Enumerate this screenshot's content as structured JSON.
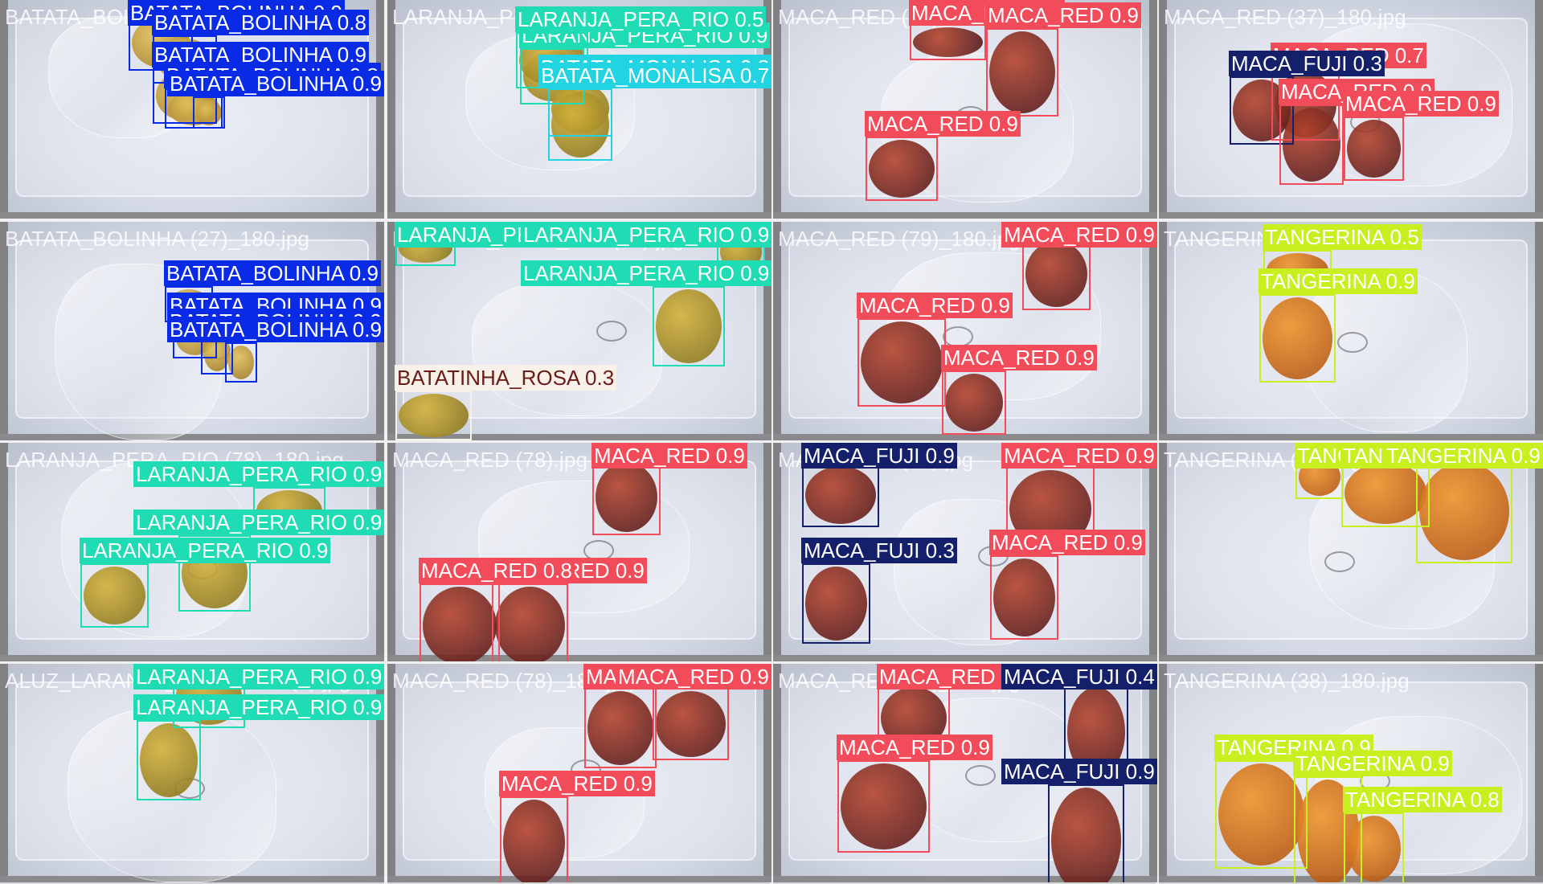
{
  "classes": {
    "BATATA_BOLINHA": {
      "color": "#0a2be6",
      "text": "#ffffff"
    },
    "LARANJA_PERA_RIO": {
      "color": "#1fdcb5",
      "text": "#ffffff"
    },
    "BATATA_MONALISA": {
      "color": "#22d3e1",
      "text": "#ffffff"
    },
    "MACA_RED": {
      "color": "#f24b5a",
      "text": "#ffffff"
    },
    "MACA_FUJI": {
      "color": "#15206b",
      "text": "#ffffff"
    },
    "TANGERINA": {
      "color": "#c8f021",
      "text": "#ffffff"
    },
    "BATATINHA_ROSA": {
      "color": "#f7f1ea",
      "text": "#6a1c16"
    }
  },
  "tiles": [
    {
      "filename": "BATATA_BOLINHA (27)_180.jpg",
      "produce": "potato",
      "detections": [
        {
          "cls": "BATATA_BOLINHA",
          "conf": "0.9"
        },
        {
          "cls": "BATATA_BOLINHA",
          "conf": "0.8"
        },
        {
          "cls": "BATATA_BOLINHA",
          "conf": "0.9"
        },
        {
          "cls": "BATATA_BOLINHA",
          "conf": "0.8"
        },
        {
          "cls": "BATATA_BOLINHA",
          "conf": "0.9"
        }
      ]
    },
    {
      "filename": "LARANJA_PERA_RIO (79)_180.jpg",
      "produce": "orange",
      "detections": [
        {
          "cls": "LARANJA_PERA_RIO",
          "conf": "0.9"
        },
        {
          "cls": "LARANJA_PERA_RIO",
          "conf": "0.5"
        },
        {
          "cls": "BATATA_MONALISA",
          "conf": "0.8"
        },
        {
          "cls": "BATATA_MONALISA",
          "conf": "0.7"
        }
      ]
    },
    {
      "filename": "MACA_RED (36)_180.jpg",
      "produce": "apple",
      "detections": [
        {
          "cls": "MACA_RED",
          "conf": "0.9"
        },
        {
          "cls": "MACA_RED",
          "conf": "0.9"
        },
        {
          "cls": "MACA_RED",
          "conf": "0.9"
        }
      ]
    },
    {
      "filename": "MACA_RED (37)_180.jpg",
      "produce": "apple",
      "detections": [
        {
          "cls": "MACA_RED",
          "conf": "0.7"
        },
        {
          "cls": "MACA_FUJI",
          "conf": "0.3"
        },
        {
          "cls": "MACA_RED",
          "conf": "0.9"
        },
        {
          "cls": "MACA_RED",
          "conf": "0.9"
        }
      ]
    },
    {
      "filename": "BATATA_BOLINHA (27)_180.jpg",
      "produce": "potato",
      "detections": [
        {
          "cls": "BATATA_BOLINHA",
          "conf": "0.9"
        },
        {
          "cls": "BATATA_BOLINHA",
          "conf": "0.9"
        },
        {
          "cls": "BATATA_BOLINHA",
          "conf": "0.9"
        },
        {
          "cls": "BATATA_BOLINHA",
          "conf": "0.9"
        }
      ]
    },
    {
      "filename": "LARANJA_PERA_RIO (80).jpg",
      "produce": "orange",
      "detections": [
        {
          "cls": "LARANJA_PERA_RIO",
          "conf": "0.9"
        },
        {
          "cls": "LARANJA_PERA_RIO",
          "conf": "0.9"
        },
        {
          "cls": "LARANJA_PERA_RIO",
          "conf": "0.9"
        },
        {
          "cls": "BATATINHA_ROSA",
          "conf": "0.3"
        }
      ]
    },
    {
      "filename": "MACA_RED (79)_180.jpg",
      "produce": "apple",
      "detections": [
        {
          "cls": "MACA_RED",
          "conf": "0.9"
        },
        {
          "cls": "MACA_RED",
          "conf": "0.9"
        },
        {
          "cls": "MACA_RED",
          "conf": "0.9"
        }
      ]
    },
    {
      "filename": "TANGERINA (39)_180.jpg",
      "produce": "tangerine",
      "detections": [
        {
          "cls": "TANGERINA",
          "conf": "0.5"
        },
        {
          "cls": "TANGERINA",
          "conf": "0.9"
        }
      ]
    },
    {
      "filename": "LARANJA_PERA_RIO (78)_180.jpg",
      "produce": "orange",
      "detections": [
        {
          "cls": "LARANJA_PERA_RIO",
          "conf": "0.9"
        },
        {
          "cls": "LARANJA_PERA_RIO",
          "conf": "0.9"
        },
        {
          "cls": "LARANJA_PERA_RIO",
          "conf": "0.9"
        }
      ]
    },
    {
      "filename": "MACA_RED (78).jpg",
      "produce": "apple",
      "detections": [
        {
          "cls": "MACA_RED",
          "conf": "0.9"
        },
        {
          "cls": "MACA_RED",
          "conf": "0.9"
        },
        {
          "cls": "MACA_RED",
          "conf": "0.8"
        }
      ]
    },
    {
      "filename": "MACA_RED (80).jpg",
      "produce": "apple",
      "detections": [
        {
          "cls": "MACA_FUJI",
          "conf": "0.9"
        },
        {
          "cls": "MACA_RED",
          "conf": "0.9"
        },
        {
          "cls": "MACA_RED",
          "conf": "0.9"
        },
        {
          "cls": "MACA_FUJI",
          "conf": "0.3"
        }
      ]
    },
    {
      "filename": "TANGERINA (38).jpg",
      "produce": "tangerine",
      "detections": [
        {
          "cls": "TANGERINA",
          "conf": "0.8"
        },
        {
          "cls": "TANGERINA",
          "conf": "0.9"
        },
        {
          "cls": "TANGERINA",
          "conf": "0.9"
        }
      ]
    },
    {
      "filename": "ALUZ_LARANJA_PERA_RIO (9).jpg",
      "produce": "orange",
      "detections": [
        {
          "cls": "LARANJA_PERA_RIO",
          "conf": "0.9"
        },
        {
          "cls": "LARANJA_PERA_RIO",
          "conf": "0.9"
        }
      ]
    },
    {
      "filename": "MACA_RED (78)_180.jpg",
      "produce": "apple",
      "detections": [
        {
          "cls": "MACA_RED",
          "conf": "0.9"
        },
        {
          "cls": "MACA_RED",
          "conf": "0.9"
        },
        {
          "cls": "MACA_RED",
          "conf": "0.9"
        }
      ]
    },
    {
      "filename": "MACA_RED (80)_180.jpg",
      "produce": "apple",
      "detections": [
        {
          "cls": "MACA_RED",
          "conf": "0.9"
        },
        {
          "cls": "MACA_FUJI",
          "conf": "0.4"
        },
        {
          "cls": "MACA_RED",
          "conf": "0.9"
        },
        {
          "cls": "MACA_FUJI",
          "conf": "0.9"
        }
      ]
    },
    {
      "filename": "TANGERINA (38)_180.jpg",
      "produce": "tangerine",
      "detections": [
        {
          "cls": "TANGERINA",
          "conf": "0.9"
        },
        {
          "cls": "TANGERINA",
          "conf": "0.9"
        },
        {
          "cls": "TANGERINA",
          "conf": "0.8"
        }
      ]
    }
  ]
}
